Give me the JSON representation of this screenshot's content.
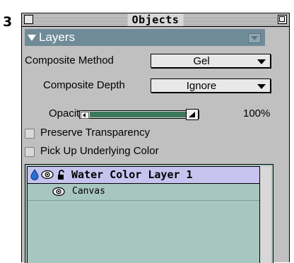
{
  "step_number": "3",
  "palette": {
    "title": "Objects",
    "section_title": "Layers",
    "composite_method": {
      "label": "Composite Method",
      "value": "Gel"
    },
    "composite_depth": {
      "label": "Composite Depth",
      "value": "Ignore"
    },
    "opacity": {
      "label": "Opacity",
      "value_text": "100%",
      "level": 1.0
    },
    "preserve_transparency": {
      "label": "Preserve Transparency",
      "checked": false
    },
    "pick_up_underlying_color": {
      "label": "Pick Up Underlying Color",
      "checked": false
    },
    "layers": [
      {
        "name": "Water Color Layer 1",
        "selected": true,
        "icons": [
          "water-drop-icon",
          "eye-icon",
          "lock-open-icon"
        ]
      },
      {
        "name": "Canvas",
        "selected": false,
        "icons": [
          "eye-icon"
        ]
      }
    ],
    "colors": {
      "section_header": "#6f8b97",
      "slider_fill": "#3d7a5c",
      "list_background": "#a8c6c0",
      "selected_row": "#c6c4ee",
      "water_drop": "#2a6fd6"
    }
  }
}
